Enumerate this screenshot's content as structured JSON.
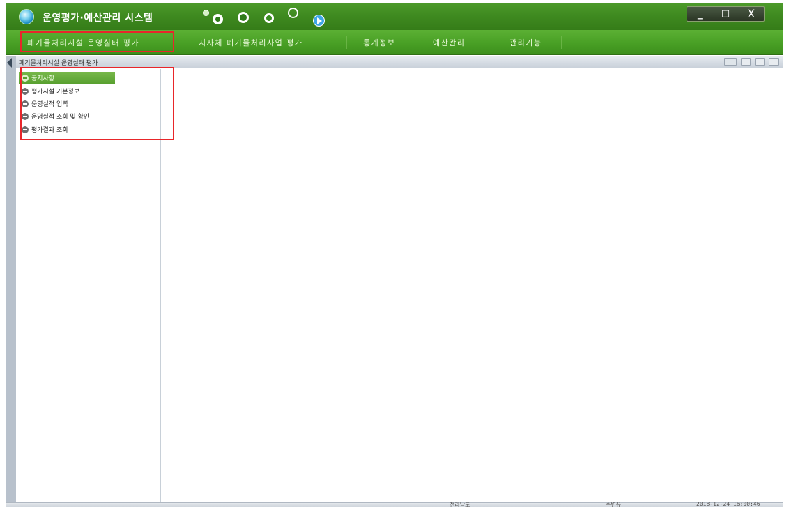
{
  "app": {
    "title": "운영평가·예산관리 시스템"
  },
  "window_controls": {
    "minimize": "_",
    "maximize": "□",
    "close": "X"
  },
  "menu": {
    "items": [
      {
        "label": "폐기물처리시설 운영실태 평가",
        "selected": true
      },
      {
        "label": "지자체 폐기물처리사업 평가"
      },
      {
        "label": "통계정보"
      },
      {
        "label": "예산관리"
      },
      {
        "label": "관리기능"
      }
    ]
  },
  "panel": {
    "title": "폐기물처리시설 운영실태 평가"
  },
  "sidebar": {
    "items": [
      {
        "label": "공지사항",
        "selected": true
      },
      {
        "label": "평가시설 기본정보"
      },
      {
        "label": "운영실적 입력"
      },
      {
        "label": "운영실적 조회 및 확인"
      },
      {
        "label": "평가결과 조회"
      }
    ]
  },
  "status": {
    "region": "전라남도",
    "user": "수변유",
    "datetime": "2018-12-24 16:00:46"
  },
  "colors": {
    "titlebar": "#3f8a20",
    "menubar": "#4aa126",
    "selected_item": "#58a030",
    "highlight": "#e8262a"
  },
  "icons": [
    "app-logo-icon",
    "toolbar-dot-icon",
    "toolbar-recycle-icon",
    "toolbar-refresh-icon",
    "toolbar-sync-icon",
    "toolbar-search-icon",
    "toolbar-play-icon"
  ]
}
